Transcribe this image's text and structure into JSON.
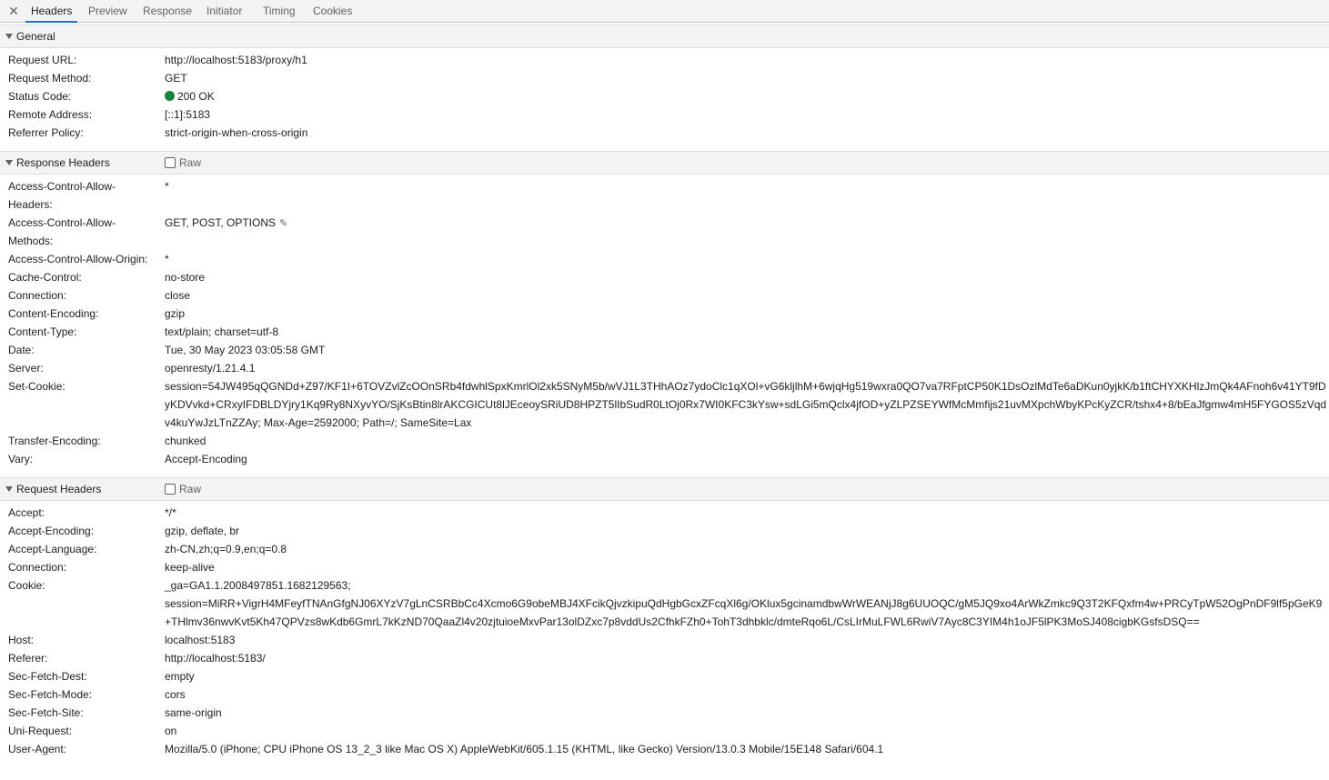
{
  "tabs": {
    "close": "✕",
    "items": [
      "Headers",
      "Preview",
      "Response",
      "Initiator",
      "Timing",
      "Cookies"
    ]
  },
  "general": {
    "title": "General",
    "request_url_key": "Request URL:",
    "request_url": "http://localhost:5183/proxy/h1",
    "request_method_key": "Request Method:",
    "request_method": "GET",
    "status_code_key": "Status Code:",
    "status_code": "200 OK",
    "status_color": "#188038",
    "remote_address_key": "Remote Address:",
    "remote_address": "[::1]:5183",
    "referrer_policy_key": "Referrer Policy:",
    "referrer_policy": "strict-origin-when-cross-origin"
  },
  "response_headers": {
    "title": "Response Headers",
    "raw_label": "Raw",
    "items": [
      {
        "key": "Access-Control-Allow-Headers:",
        "value": "*"
      },
      {
        "key": "Access-Control-Allow-Methods:",
        "value": "GET, POST, OPTIONS"
      },
      {
        "key": "Access-Control-Allow-Origin:",
        "value": "*"
      },
      {
        "key": "Cache-Control:",
        "value": "no-store"
      },
      {
        "key": "Connection:",
        "value": "close"
      },
      {
        "key": "Content-Encoding:",
        "value": "gzip"
      },
      {
        "key": "Content-Type:",
        "value": "text/plain; charset=utf-8"
      },
      {
        "key": "Date:",
        "value": "Tue, 30 May 2023 03:05:58 GMT"
      },
      {
        "key": "Server:",
        "value": "openresty/1.21.4.1"
      },
      {
        "key": "Set-Cookie:",
        "value": "session=54JW495qQGNDd+Z97/KF1I+6TOVZvlZcOOnSRb4fdwhlSpxKmrlOl2xk5SNyM5b/wVJ1L3THhAOz7ydoClc1qXOl+vG6kljlhM+6wjqHg519wxra0QO7va7RFptCP50K1DsOzlMdTe6aDKun0yjkK/b1ftCHYXKHlzJmQk4AFnoh6v41YT9fDyKDVvkd+CRxyIFDBLDYjry1Kq9Ry8NXyvYO/SjKsBtin8lrAKCGICUt8lJEceoySRiUD8HPZT5lIbSudR0LtOj0Rx7WI0KFC3kYsw+sdLGi5mQclx4jfOD+yZLPZSEYWfMcMmfijs21uvMXpchWbyKPcKyZCR/tshx4+8/bEaJfgmw4mH5FYGOS5zVqdv4kuYwJzLTnZZAy; Max-Age=2592000; Path=/; SameSite=Lax"
      },
      {
        "key": "Transfer-Encoding:",
        "value": "chunked"
      },
      {
        "key": "Vary:",
        "value": "Accept-Encoding"
      }
    ]
  },
  "request_headers": {
    "title": "Request Headers",
    "raw_label": "Raw",
    "items": [
      {
        "key": "Accept:",
        "value": "*/*"
      },
      {
        "key": "Accept-Encoding:",
        "value": "gzip, deflate, br"
      },
      {
        "key": "Accept-Language:",
        "value": "zh-CN,zh;q=0.9,en;q=0.8"
      },
      {
        "key": "Connection:",
        "value": "keep-alive"
      },
      {
        "key": "Cookie:",
        "value": "_ga=GA1.1.2008497851.1682129563;",
        "value2": "session=MiRR+VigrH4MFeyfTNAnGfgNJ06XYzV7gLnCSRBbCc4Xcmo6G9obeMBJ4XFcikQjvzkipuQdHgbGcxZFcqXl6g/OKlux5gcinamdbwWrWEANjJ8g6UUOQC/gM5JQ9xo4ArWkZmkc9Q3T2KFQxfm4w+PRCyTpW52OgPnDF9lf5pGeK9+THlmv36nwvKvt5Kh47QPVzs8wKdb6GmrL7kKzND70QaaZl4v20zjtuioeMxvPar13olDZxc7p8vddUs2CfhkFZh0+TohT3dhbklc/dmteRqo6L/CsLIrMuLFWL6RwiV7Ayc8C3YIM4h1oJF5lPK3MoSJ408cigbKGsfsDSQ=="
      },
      {
        "key": "Host:",
        "value": "localhost:5183"
      },
      {
        "key": "Referer:",
        "value": "http://localhost:5183/"
      },
      {
        "key": "Sec-Fetch-Dest:",
        "value": "empty"
      },
      {
        "key": "Sec-Fetch-Mode:",
        "value": "cors"
      },
      {
        "key": "Sec-Fetch-Site:",
        "value": "same-origin"
      },
      {
        "key": "Uni-Request:",
        "value": "on"
      },
      {
        "key": "User-Agent:",
        "value": "Mozilla/5.0 (iPhone; CPU iPhone OS 13_2_3 like Mac OS X) AppleWebKit/605.1.15 (KHTML, like Gecko) Version/13.0.3 Mobile/15E148 Safari/604.1"
      }
    ]
  }
}
